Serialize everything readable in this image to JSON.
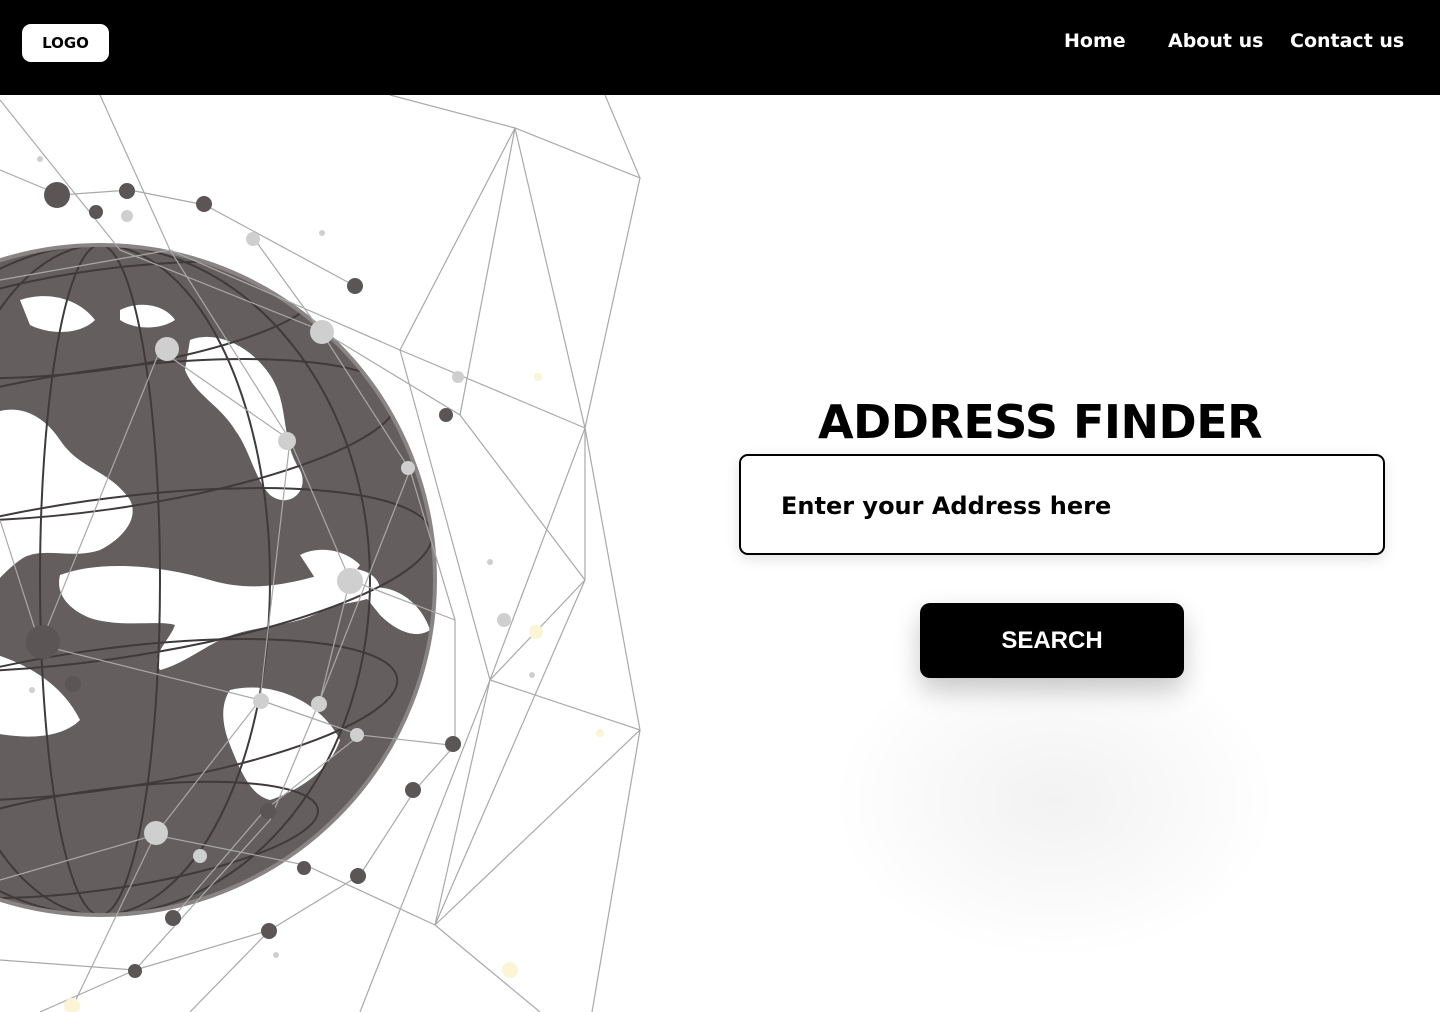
{
  "header": {
    "logo": "LOGO",
    "nav": {
      "home": "Home",
      "about": "About us",
      "contact": "Contact us"
    }
  },
  "hero": {
    "title": "ADDRESS FINDER",
    "search": {
      "placeholder": "Enter your Address here",
      "value": "",
      "button_label": "SEARCH"
    }
  },
  "colors": {
    "nav_background": "#000000",
    "globe_land": "#615b5c",
    "lines": "#9a9a9a",
    "button_background": "#000000"
  },
  "icons": {
    "hero_illustration": "globe-network-illustration"
  }
}
